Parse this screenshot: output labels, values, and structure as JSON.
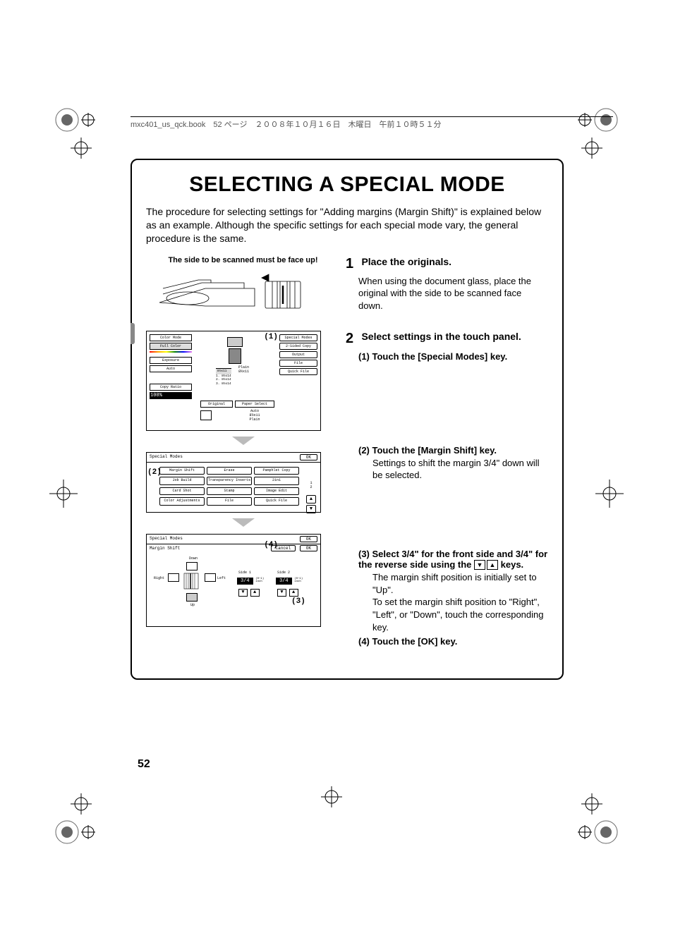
{
  "header_text": "mxc401_us_qck.book　52 ページ　２００８年１０月１６日　木曜日　午前１０時５１分",
  "title": "SELECTING A SPECIAL MODE",
  "intro": "The procedure for selecting settings for \"Adding margins (Margin Shift)\" is explained below as an example. Although the specific settings for each special mode vary, the general procedure is the same.",
  "caption1": "The side to be scanned must be face up!",
  "step1": {
    "num": "1",
    "head": "Place the originals.",
    "body": "When using the document glass, place the original with the side to be scanned face down."
  },
  "step2": {
    "num": "2",
    "head": "Select settings in the touch panel.",
    "sub1_n": "(1)",
    "sub1_t": "Touch the [Special Modes] key.",
    "sub2_n": "(2)",
    "sub2_t": "Touch the [Margin Shift] key.",
    "sub2_d": "Settings to shift the margin 3/4\" down will be selected.",
    "sub3_n": "(3)",
    "sub3_t_a": "Select 3/4\" for the front side and 3/4\" for the reverse side using the ",
    "sub3_t_b": " keys.",
    "sub3_d": "The margin shift position is initially set to \"Up\".\nTo set the margin shift position to \"Right\", \"Left\", or \"Down\", touch the corresponding key.",
    "sub4_n": "(4)",
    "sub4_t": "Touch the [OK] key."
  },
  "screen1": {
    "color_mode": "Color Mode",
    "full_color": "Full Color",
    "exposure": "Exposure",
    "auto": "Auto",
    "copy_ratio": "Copy Ratio",
    "ratio": "100%",
    "original": "Original",
    "paper_select": "Paper Select",
    "auto2": "Auto",
    "paper": "8½x11",
    "plain": "Plain",
    "plain2": "8½x11",
    "tray1": "8½x11",
    "tray2": "1. 8½x14",
    "tray3": "2. 8½x14",
    "tray4": "3. 8½x14",
    "special_modes": "Special Modes",
    "two_sided": "2-Sided Copy",
    "output": "Output",
    "file": "File",
    "quick_file": "Quick File",
    "callout1": "(1)"
  },
  "screen2": {
    "header": "Special Modes",
    "ok": "OK",
    "btns": [
      "Margin Shift",
      "Erase",
      "Pamphlet Copy",
      "Job Build",
      "Transparency Inserts",
      "2in1",
      "Card Shot",
      "Stamp",
      "Image Edit",
      "Color Adjustments",
      "File",
      "Quick File"
    ],
    "page": "1\n2",
    "callout2": "(2)"
  },
  "screen3": {
    "header": "Special Modes",
    "ok": "OK",
    "margin_shift": "Margin Shift",
    "cancel": "Cancel",
    "ok2": "OK",
    "down": "Down",
    "right": "Right",
    "left": "Left",
    "up": "Up",
    "side1": "Side 1",
    "side2": "Side 2",
    "val": "3/4",
    "range": "(0~1)\ninch",
    "callout3": "(3)",
    "callout4": "(4)"
  },
  "page_number": "52"
}
